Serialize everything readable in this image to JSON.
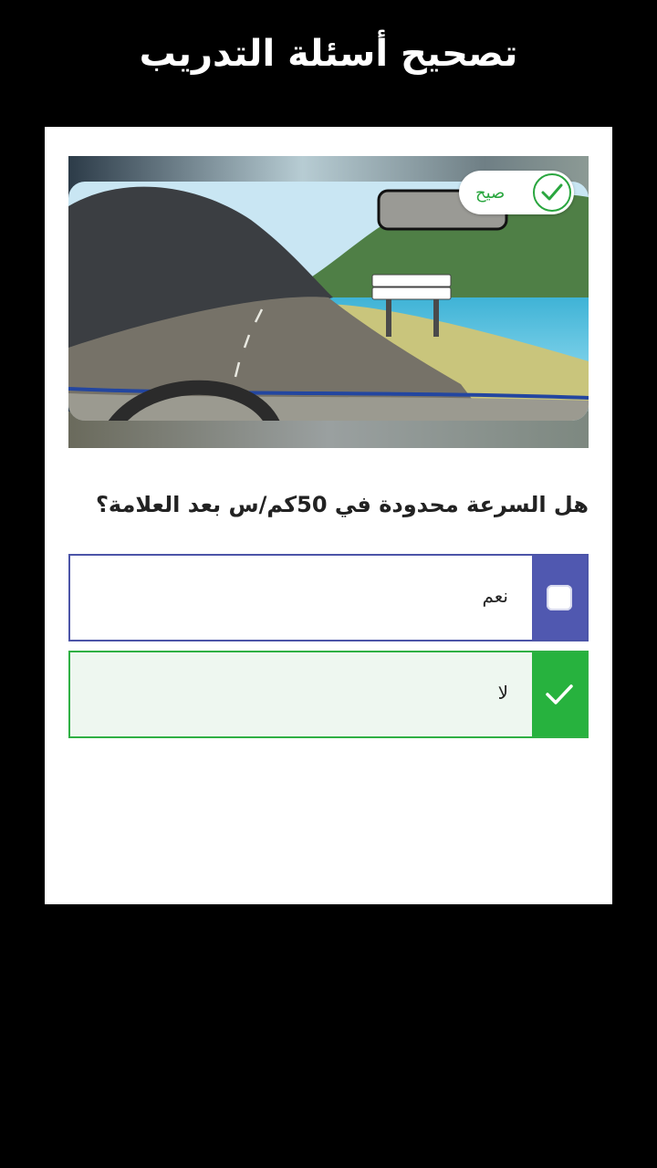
{
  "header": {
    "title": "تصحيح أسئلة التدريب"
  },
  "status_badge": {
    "label": "صيح",
    "icon": "check-icon",
    "color": "#2aa63f"
  },
  "question": {
    "text": "هل السرعة محدودة في 50كم/س بعد العلامة؟"
  },
  "answers": [
    {
      "label": "نعم",
      "selected": false,
      "state": "unchecked",
      "accent": "#5058b0",
      "icon": "checkbox-icon"
    },
    {
      "label": "لا",
      "selected": true,
      "state": "correct",
      "accent": "#27b23e",
      "icon": "check-icon"
    }
  ],
  "scene": {
    "description_icon": "road-scene-illustration"
  }
}
